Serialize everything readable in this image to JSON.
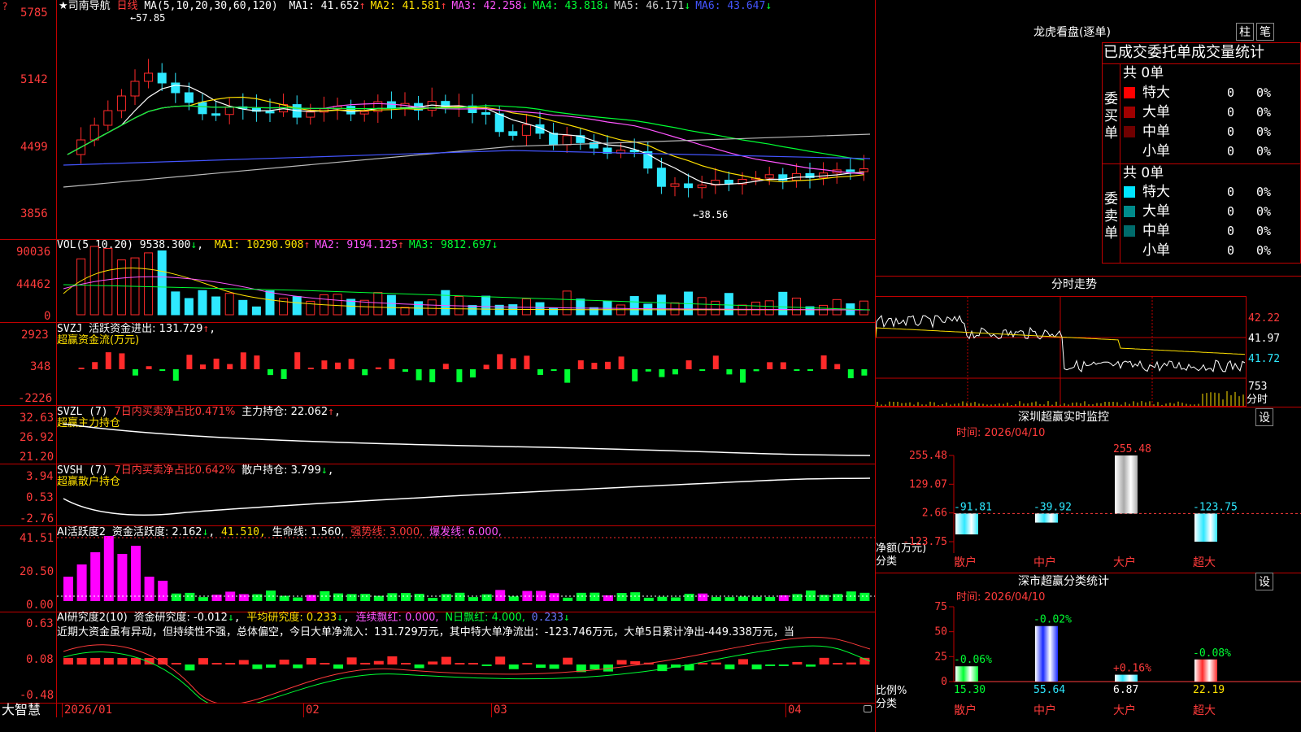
{
  "chart": {
    "title": "★司南导航",
    "period": "日线",
    "ma_label": "MA(5,10,20,30,60,120)",
    "ma": [
      {
        "name": "MA1:",
        "value": "41.652",
        "arrow": "↑",
        "color": "#ffffff"
      },
      {
        "name": "MA2:",
        "value": "41.581",
        "arrow": "↑",
        "color": "#ffe100"
      },
      {
        "name": "MA3:",
        "value": "42.258",
        "arrow": "↓",
        "color": "#ff55ff"
      },
      {
        "name": "MA4:",
        "value": "43.818",
        "arrow": "↓",
        "color": "#00ff33"
      },
      {
        "name": "MA5:",
        "value": "46.171",
        "arrow": "↓",
        "color": "#cccccc"
      },
      {
        "name": "MA6:",
        "value": "43.647",
        "arrow": "↓",
        "color": "#4455ff"
      }
    ],
    "y_ticks": [
      "5785",
      "5142",
      "4499",
      "3856"
    ],
    "high_label": "57.85",
    "low_label": "38.56",
    "x_labels": [
      "2026/01",
      "02",
      "03",
      "04"
    ]
  },
  "vol": {
    "label": "VOL(5,10,20)",
    "value": "9538.300",
    "value_arrow": "↓",
    "ma": [
      {
        "name": "MA1:",
        "value": "10290.908",
        "arrow": "↑",
        "color": "#ffe100"
      },
      {
        "name": "MA2:",
        "value": "9194.125",
        "arrow": "↑",
        "color": "#ff55ff"
      },
      {
        "name": "MA3:",
        "value": "9812.697",
        "arrow": "↓",
        "color": "#00ff33"
      }
    ],
    "y_ticks": [
      "90036",
      "44462",
      "0"
    ]
  },
  "svzj": {
    "label": "SVZJ",
    "text": "活跃资金进出: 131.729",
    "arrow": "↑",
    "sub": "超赢资金流(万元)",
    "y_ticks": [
      "2923",
      "348",
      "-2226"
    ]
  },
  "svzl": {
    "label": "SVZL (7)",
    "text1": "7日内买卖净占比0.471%",
    "text2": "主力持仓: 22.062",
    "arrow": "↑",
    "sub": "超赢主力持仓",
    "y_ticks": [
      "32.63",
      "26.92",
      "21.20"
    ]
  },
  "svsh": {
    "label": "SVSH (7)",
    "text1": "7日内买卖净占比0.642%",
    "text2": "散户持仓: 3.799",
    "arrow": "↓",
    "sub": "超赢散户持仓",
    "y_ticks": [
      "3.94",
      "0.53",
      "-2.76"
    ]
  },
  "ai1": {
    "label": "AI活跃度2",
    "t1": "资金活跃度: 2.162",
    "t2": "41.510,",
    "t3": "生命线: 1.560,",
    "t4": "强势线: 3.000,",
    "t5": "爆发线: 6.000,",
    "y_ticks": [
      "41.51",
      "20.50",
      "0.00"
    ]
  },
  "ai2": {
    "label": "AI研究度2(10)",
    "t1": "资金研究度: -0.012",
    "t2": "平均研究度: 0.233",
    "t3": "连续飘红: 0.000,",
    "t4": "N日飘红: 4.000,",
    "t5": "0.233",
    "commentary": "近期大资金虽有异动，但持续性不强，总体偏空，今日大单净流入：131.729万元，其中特大单净流出：-123.746万元，大单5日累计净出-449.338万元，当",
    "y_ticks": [
      "0.63",
      "0.08",
      "-0.48"
    ]
  },
  "footer": {
    "brand": "大智慧"
  },
  "right": {
    "lhb_title": "龙虎看盘(逐单)",
    "btn_bar": "柱",
    "btn_pen": "笔",
    "tabs_text": "已成交委托单成交量统计",
    "buy": {
      "side": "委买单",
      "total": "共 0单",
      "rows": [
        {
          "label": "特大",
          "count": "0",
          "pct": "0%",
          "color": "#ff0000"
        },
        {
          "label": "大单",
          "count": "0",
          "pct": "0%",
          "color": "#a00000"
        },
        {
          "label": "中单",
          "count": "0",
          "pct": "0%",
          "color": "#700000"
        },
        {
          "label": "小单",
          "count": "0",
          "pct": "0%",
          "color": "#000000"
        }
      ]
    },
    "sell": {
      "side": "委卖单",
      "total": "共 0单",
      "rows": [
        {
          "label": "特大",
          "count": "0",
          "pct": "0%",
          "color": "#00e5ff"
        },
        {
          "label": "大单",
          "count": "0",
          "pct": "0%",
          "color": "#008a8a"
        },
        {
          "label": "中单",
          "count": "0",
          "pct": "0%",
          "color": "#006b6b"
        },
        {
          "label": "小单",
          "count": "0",
          "pct": "0%",
          "color": "#000000"
        }
      ]
    },
    "intraday": {
      "title": "分时走势",
      "ticks": [
        "42.22",
        "41.97",
        "41.72"
      ],
      "vol_tick": "753",
      "vol_label": "分时"
    },
    "monitor": {
      "title": "深圳超赢实时监控",
      "btn": "设",
      "date": "时间: 2026/04/10",
      "y_ticks": [
        "255.48",
        "129.07",
        "2.66",
        "-123.75"
      ],
      "y_label_1": "净额(万元)",
      "y_label_2": "分类",
      "categories": [
        "散户",
        "中户",
        "大户",
        "超大"
      ],
      "values": [
        "-91.81",
        "-39.92",
        "255.48",
        "-123.75"
      ]
    },
    "classify": {
      "title": "深市超赢分类统计",
      "btn": "设",
      "date": "时间: 2026/04/10",
      "y_ticks": [
        "75",
        "50",
        "25",
        "0"
      ],
      "y_label_1": "比例%",
      "y_label_2": "分类",
      "categories": [
        "散户",
        "中户",
        "大户",
        "超大"
      ],
      "values": [
        "15.30",
        "55.64",
        "6.87",
        "22.19"
      ],
      "changes": [
        "-0.06%",
        "-0.02%",
        "+0.16%",
        "-0.08%"
      ]
    }
  }
}
